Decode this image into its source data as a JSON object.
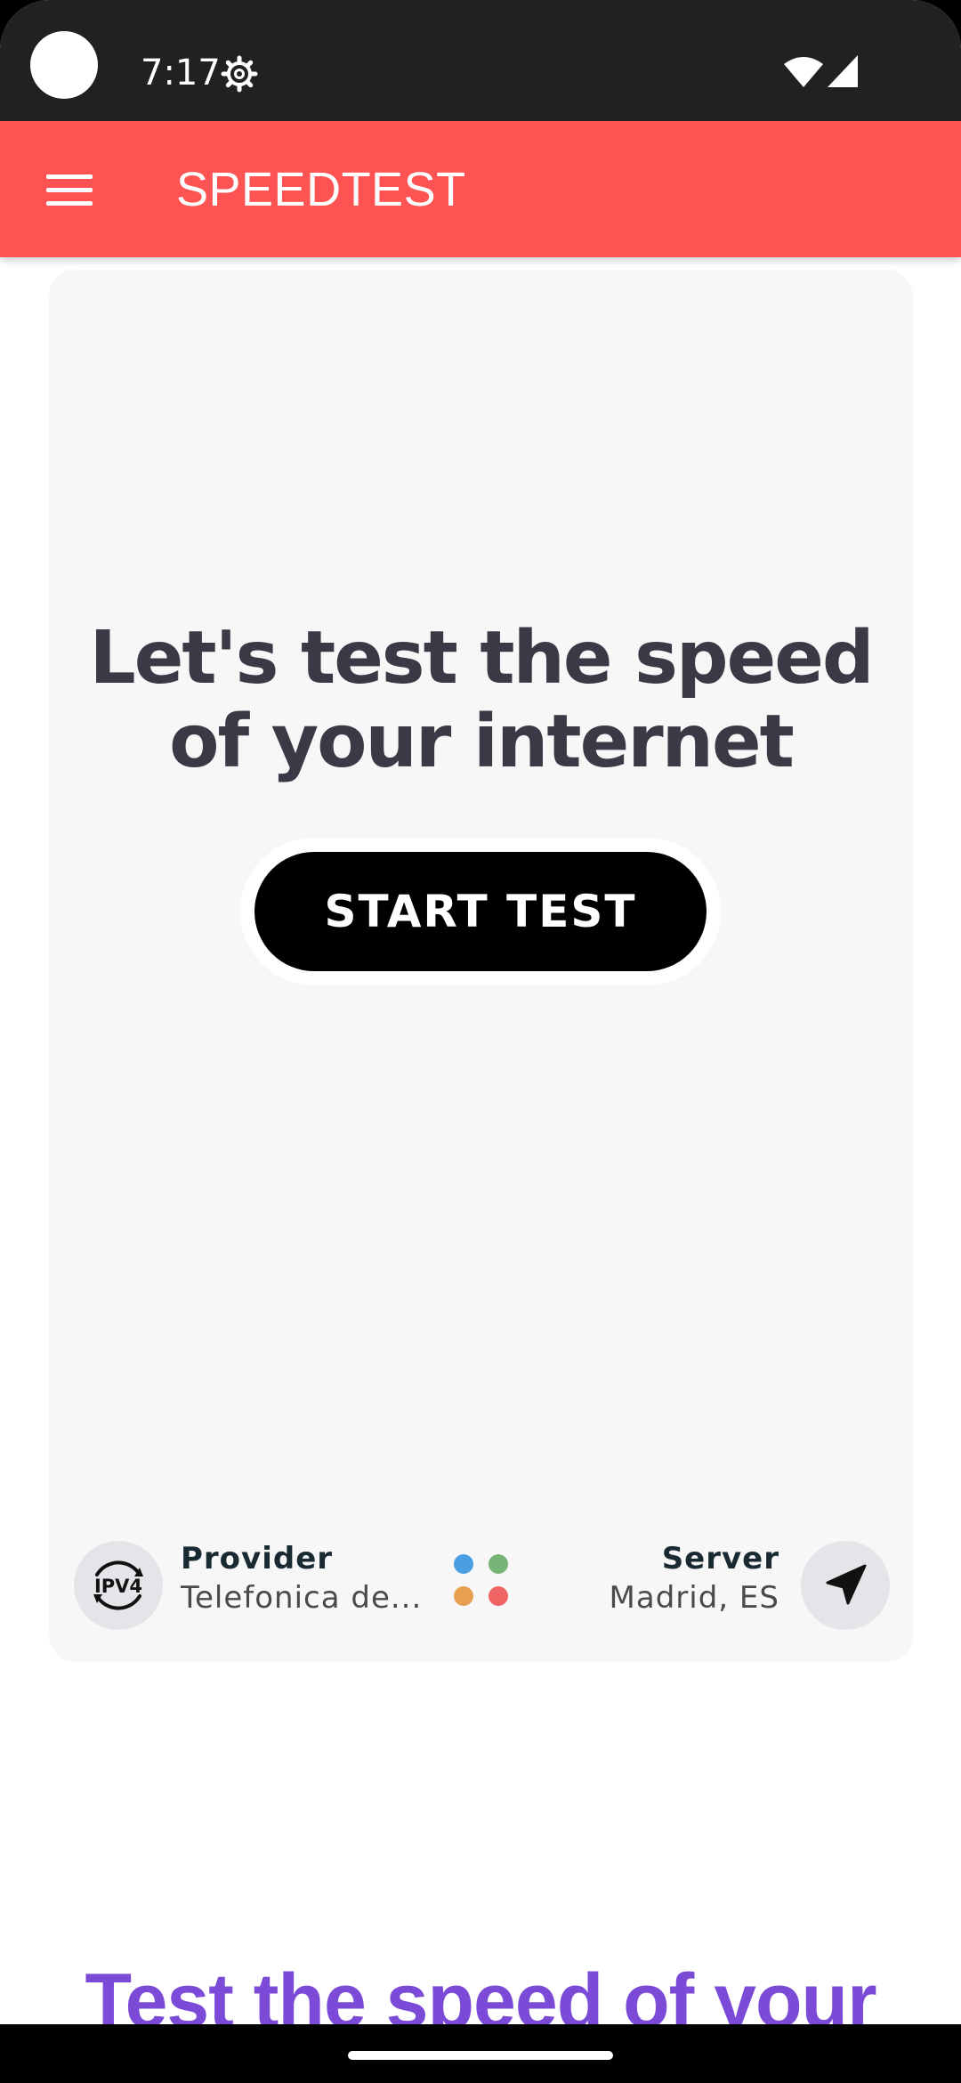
{
  "status_bar": {
    "time": "7:17",
    "icons": [
      "settings-gear-icon",
      "wifi-icon",
      "cell-signal-icon"
    ]
  },
  "app_bar": {
    "title": "SPEEDTEST",
    "menu_icon": "hamburger-menu-icon",
    "color": "#fe5353"
  },
  "hero": {
    "headline_before": "Let's test the speed of your ",
    "headline_highlight": "internet",
    "start_button_label": "START TEST"
  },
  "connection": {
    "ip_badge": "IPV4",
    "provider_label": "Provider",
    "provider_value": "Telefonica de...",
    "server_label": "Server",
    "server_value": "Madrid, ES",
    "status_dot_colors": [
      "#4a9fe3",
      "#77b577",
      "#e8a050",
      "#f06464"
    ],
    "location_icon": "navigation-arrow-icon"
  },
  "promo": {
    "heading": "Test the speed of your"
  }
}
